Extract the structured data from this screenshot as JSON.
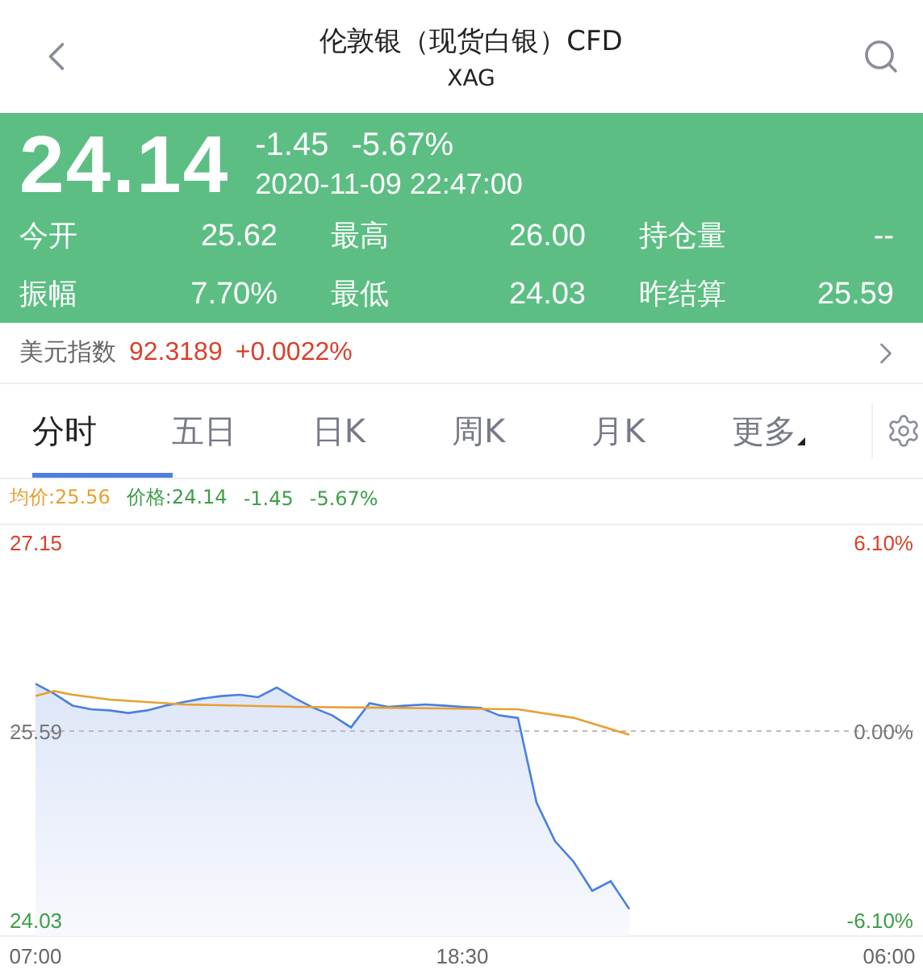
{
  "header": {
    "title": "伦敦银（现货白银）CFD",
    "code": "XAG"
  },
  "quote": {
    "price": "24.14",
    "change": "-1.45",
    "change_pct": "-5.67%",
    "time": "2020-11-09 22:47:00"
  },
  "stats": [
    {
      "label": "今开",
      "value": "25.62"
    },
    {
      "label": "最高",
      "value": "26.00"
    },
    {
      "label": "持仓量",
      "value": "--"
    },
    {
      "label": "振幅",
      "value": "7.70%"
    },
    {
      "label": "最低",
      "value": "24.03"
    },
    {
      "label": "昨结算",
      "value": "25.59"
    }
  ],
  "index_bar": {
    "label": "美元指数",
    "value": "92.3189",
    "change": "+0.0022%"
  },
  "tabs": [
    {
      "label": "分时",
      "selected": true
    },
    {
      "label": "五日",
      "selected": false
    },
    {
      "label": "日K",
      "selected": false
    },
    {
      "label": "周K",
      "selected": false
    },
    {
      "label": "月K",
      "selected": false
    },
    {
      "label": "更多",
      "selected": false,
      "kind": "dropdown"
    }
  ],
  "legend": [
    {
      "text": "均价:25.56",
      "color": "#e8a030"
    },
    {
      "text": "价格:24.14",
      "color": "#3e9e4a"
    },
    {
      "text": "-1.45",
      "color": "#3e9e4a"
    },
    {
      "text": "-5.67%",
      "color": "#3e9e4a"
    }
  ],
  "percent_labels": [
    "6.10%",
    "0.00%",
    "-6.10%"
  ],
  "chart_data": {
    "type": "line",
    "categories": [
      "07:00",
      null,
      null,
      null,
      null,
      null,
      null,
      null,
      null,
      null,
      null,
      null,
      null,
      null,
      null,
      null,
      null,
      null,
      null,
      null,
      null,
      null,
      null,
      "18:30",
      null,
      null,
      null,
      null,
      null,
      null,
      null,
      null,
      null,
      null,
      null,
      null,
      null,
      null,
      null,
      null,
      null,
      null,
      null,
      null,
      null,
      null,
      "06:00"
    ],
    "ylim": [
      24.03,
      27.15
    ],
    "yticks": [
      {
        "value": 27.15,
        "label": "27.15"
      },
      {
        "value": 25.59,
        "label": "25.59"
      },
      {
        "value": 24.03,
        "label": "24.03"
      }
    ],
    "series": [
      {
        "color": "#4a7fe0",
        "values": [
          25.98,
          25.9,
          25.8,
          25.77,
          25.76,
          25.74,
          25.76,
          25.8,
          25.83,
          25.86,
          25.88,
          25.89,
          25.87,
          25.95,
          25.86,
          25.78,
          25.72,
          25.62,
          25.82,
          25.79,
          25.8,
          25.81,
          25.8,
          25.79,
          25.78,
          25.72,
          25.7,
          25.0,
          24.68,
          24.51,
          24.27,
          24.35,
          24.12,
          null,
          null,
          null,
          null,
          null,
          null,
          null,
          null,
          null,
          null,
          null,
          null,
          null,
          null
        ]
      },
      {
        "color": "#e8a030",
        "values": [
          25.88,
          25.92,
          25.89,
          null,
          25.85,
          null,
          null,
          null,
          25.81,
          null,
          null,
          null,
          null,
          null,
          25.79,
          null,
          null,
          null,
          null,
          null,
          25.78,
          null,
          null,
          null,
          null,
          null,
          25.77,
          null,
          null,
          25.7,
          null,
          null,
          25.56,
          null,
          null,
          null,
          null,
          null,
          null,
          null,
          null,
          null,
          null,
          null,
          null,
          null,
          null
        ]
      }
    ]
  }
}
